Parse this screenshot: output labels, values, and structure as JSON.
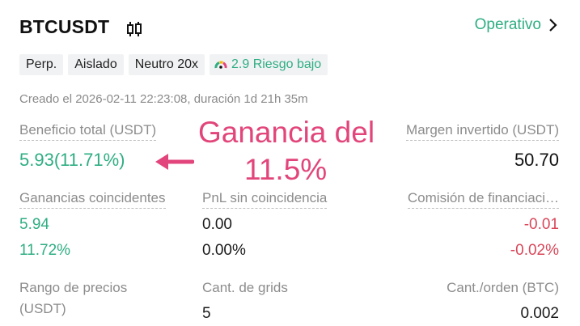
{
  "header": {
    "title": "BTCUSDT",
    "status_label": "Operativo"
  },
  "tags": [
    "Perp.",
    "Aislado",
    "Neutro 20x"
  ],
  "risk_tag": {
    "label": "2.9 Riesgo bajo"
  },
  "created_text": "Creado el 2026-02-11 22:23:08, duración 1d 21h 35m",
  "summary": {
    "total_profit_label": "Beneficio total (USDT)",
    "total_profit_value": "5.93(11.71%)",
    "margin_label": "Margen invertido (USDT)",
    "margin_value": "50.70"
  },
  "annotation": {
    "line1": "Ganancia del",
    "line2": "11.5%"
  },
  "stats": {
    "matched_label": "Ganancias coincidentes",
    "matched_value": "5.94",
    "matched_pct": "11.72%",
    "unmatched_label": "PnL sin coincidencia",
    "unmatched_value": "0.00",
    "unmatched_pct": "0.00%",
    "funding_label": "Comisión de financiaci…",
    "funding_value": "-0.01",
    "funding_pct": "-0.02%"
  },
  "params": {
    "range_label_line1": "Rango de precios",
    "range_label_line2": "(USDT)",
    "grids_label": "Cant. de grids",
    "grids_value": "5",
    "per_order_label": "Cant./orden (BTC)",
    "per_order_value": "0.002"
  },
  "colors": {
    "positive": "#2fae82",
    "negative": "#d9475a",
    "annotation": "#e2457b"
  }
}
